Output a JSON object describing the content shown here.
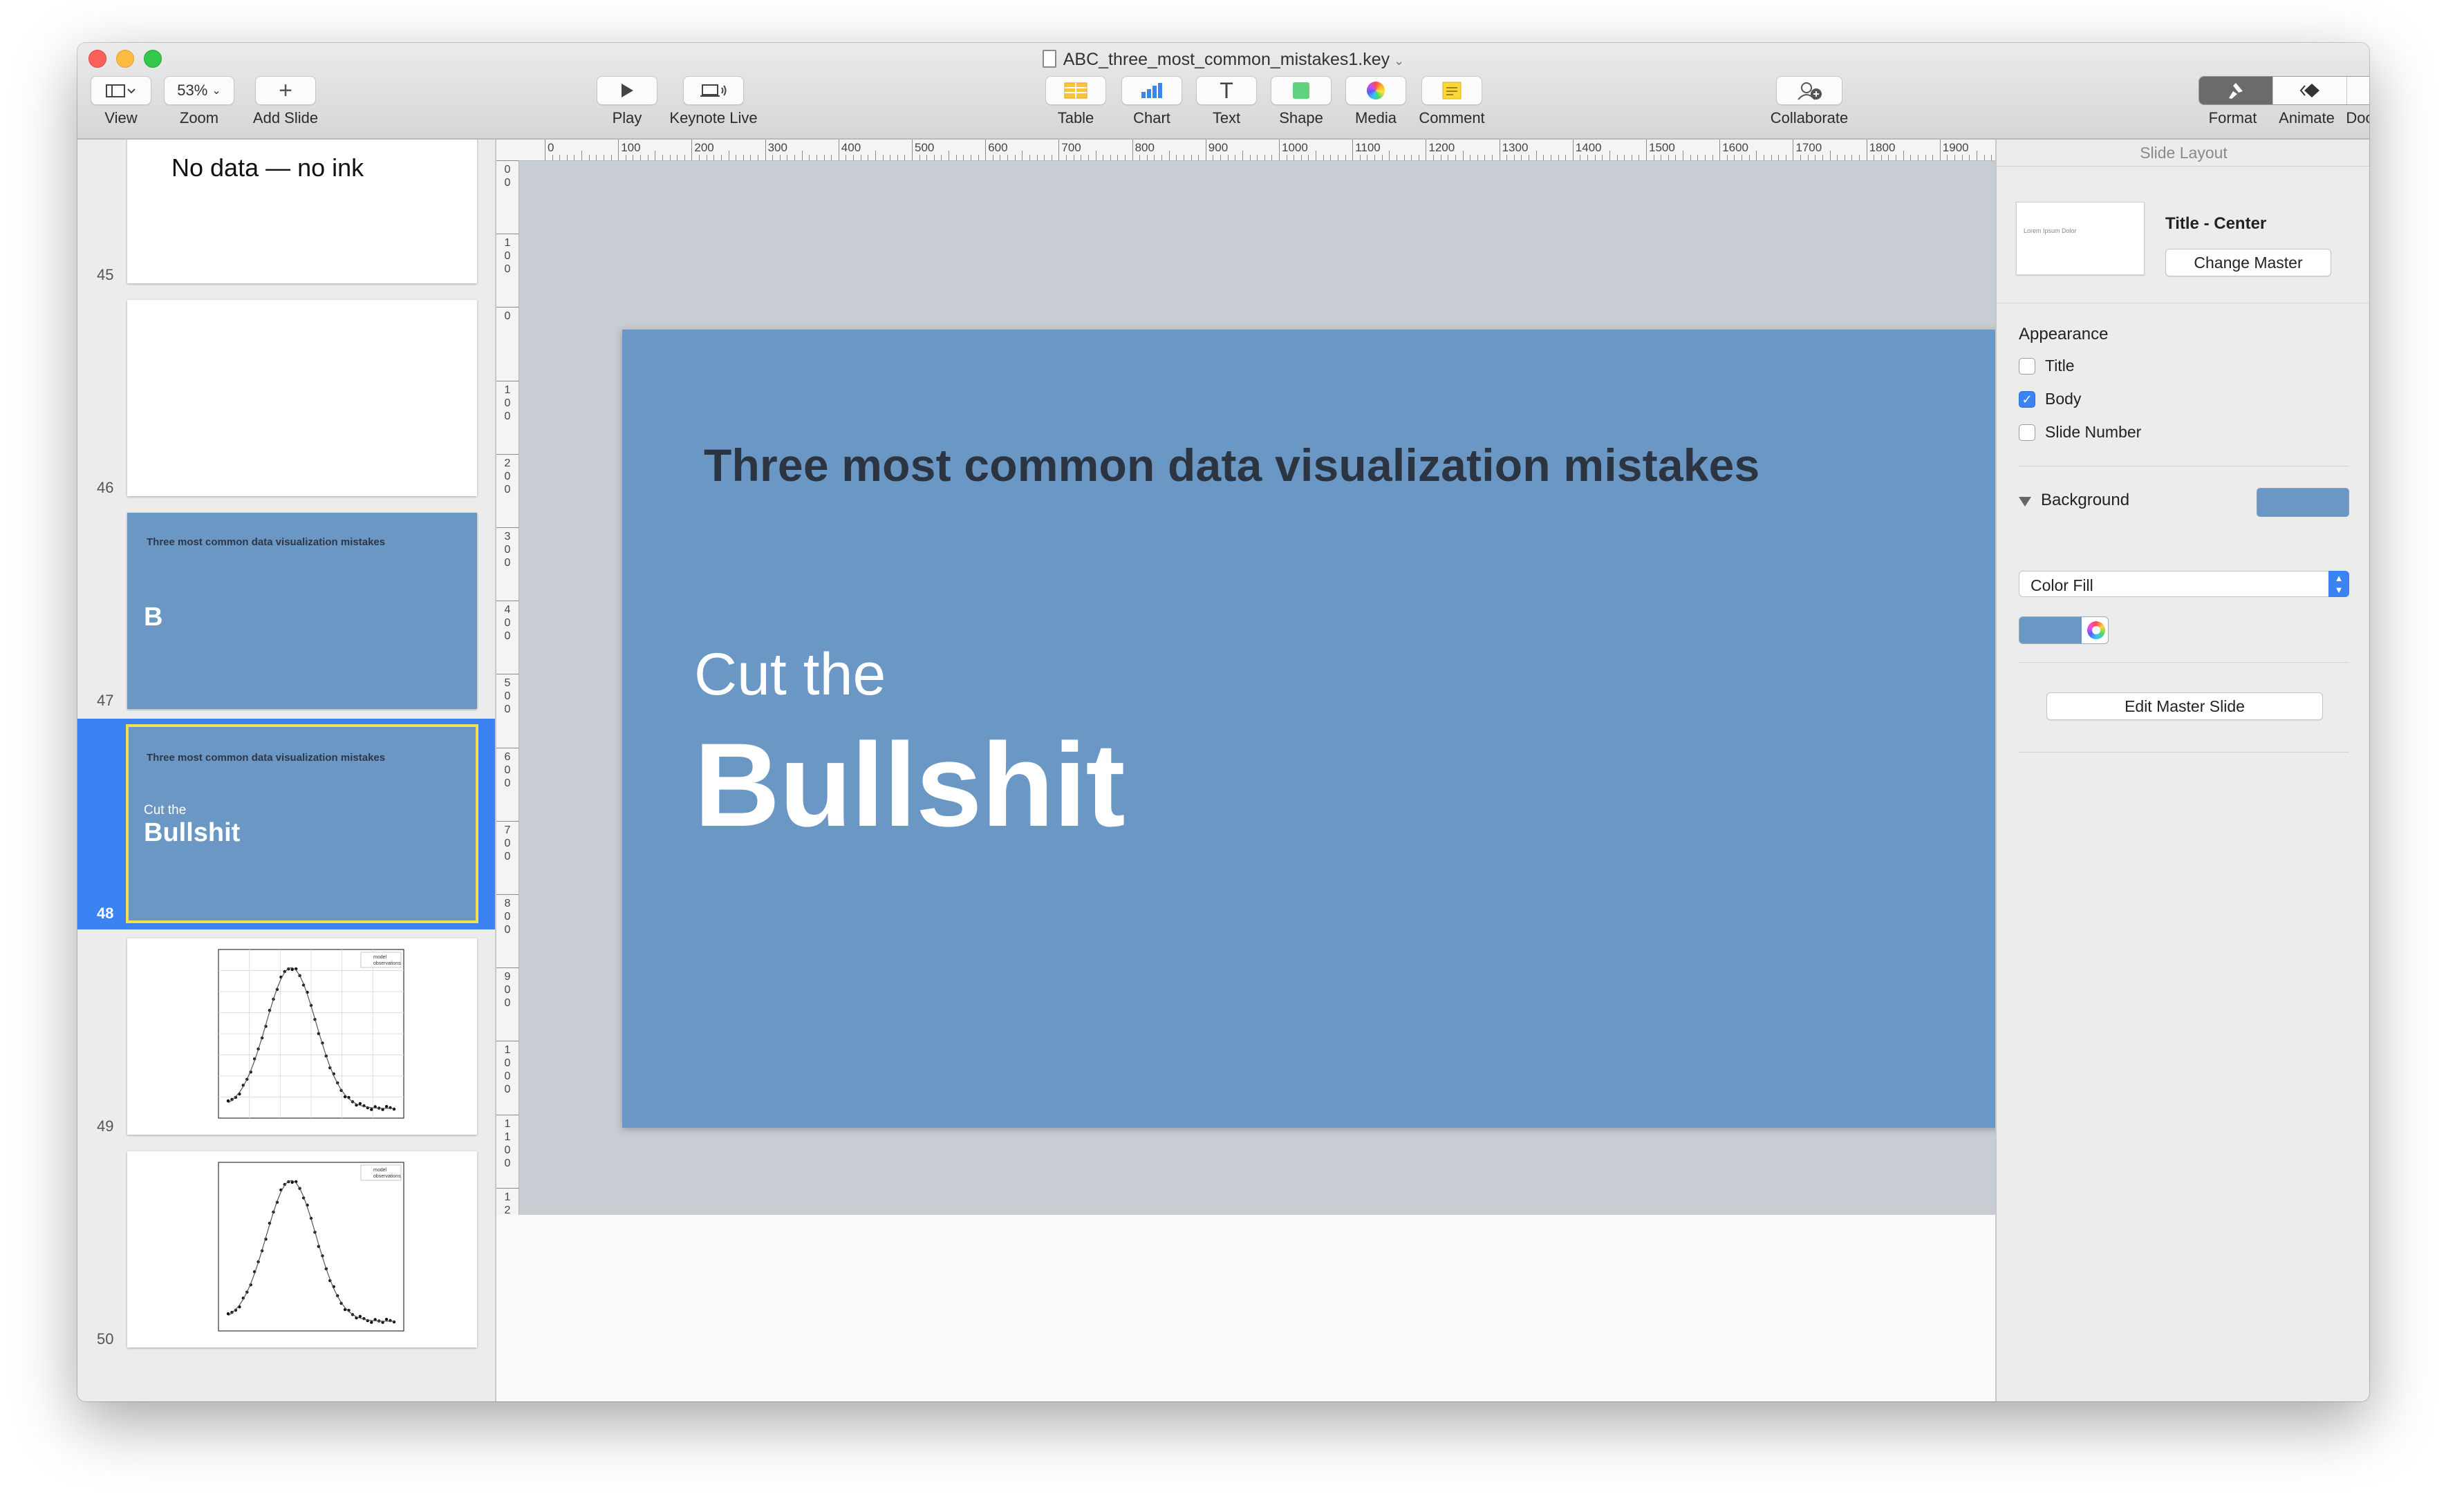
{
  "window": {
    "title": "ABC_three_most_common_mistakes1.key"
  },
  "toolbar": {
    "view": {
      "label": "View"
    },
    "zoom": {
      "value": "53%",
      "label": "Zoom"
    },
    "add_slide": {
      "label": "Add Slide"
    },
    "play": {
      "label": "Play"
    },
    "keynote_live": {
      "label": "Keynote Live"
    },
    "table": {
      "label": "Table"
    },
    "chart": {
      "label": "Chart"
    },
    "text": {
      "label": "Text",
      "glyph": "T"
    },
    "shape": {
      "label": "Shape"
    },
    "media": {
      "label": "Media"
    },
    "comment": {
      "label": "Comment"
    },
    "collaborate": {
      "label": "Collaborate"
    },
    "format": {
      "label": "Format"
    },
    "animate": {
      "label": "Animate"
    },
    "document": {
      "label": "Document"
    }
  },
  "navigator": {
    "slides": [
      {
        "number": "45",
        "text": "No data — no ink",
        "background": "#ffffff"
      },
      {
        "number": "46",
        "background": "#ffffff"
      },
      {
        "number": "47",
        "title": "Three most common data visualization mistakes",
        "big": "B",
        "background": "#6a97c4"
      },
      {
        "number": "48",
        "title": "Three most common data visualization mistakes",
        "small": "Cut the",
        "big": "Bullshit",
        "background": "#6a97c4",
        "selected": true
      },
      {
        "number": "49",
        "content": "line chart",
        "legend": [
          "model",
          "observations"
        ]
      },
      {
        "number": "50",
        "content": "line chart",
        "legend": [
          "model",
          "observations"
        ]
      }
    ]
  },
  "rulers": {
    "top_labels": [
      "0",
      "100",
      "200",
      "300",
      "400",
      "500",
      "600",
      "700",
      "800",
      "900",
      "1000",
      "1100",
      "1200",
      "1300",
      "1400",
      "1500",
      "1600",
      "1700",
      "1800",
      "1900"
    ],
    "left_labels": [
      "0 0",
      "1 0 0",
      "0",
      "1 0 0",
      "2 0 0",
      "3 0 0",
      "4 0 0",
      "5 0 0",
      "6 0 0",
      "7 0 0",
      "8 0 0",
      "9 0 0",
      "1 0 0 0",
      "1 1 0 0",
      "1 2"
    ]
  },
  "slide": {
    "title": "Three most common data visualization mistakes",
    "small": "Cut the",
    "big": "Bullshit",
    "background_color": "#6a97c4"
  },
  "inspector": {
    "header": "Slide Layout",
    "master_thumb_text": "Lorem Ipsum Dolor",
    "master_name": "Title - Center",
    "change_master": "Change Master",
    "appearance_label": "Appearance",
    "checkboxes": [
      {
        "label": "Title",
        "checked": false
      },
      {
        "label": "Body",
        "checked": true
      },
      {
        "label": "Slide Number",
        "checked": false
      }
    ],
    "background_label": "Background",
    "fill_type": "Color Fill",
    "edit_master": "Edit Master Slide",
    "accent_color": "#3b82f2",
    "background_color": "#6a97c4"
  },
  "icons": [
    "view-icon",
    "add-icon",
    "play-icon",
    "keynote-live-icon",
    "table-icon",
    "chart-icon",
    "text-icon",
    "shape-icon",
    "media-icon",
    "comment-icon",
    "collaborate-icon",
    "format-icon",
    "animate-icon",
    "document-icon"
  ]
}
